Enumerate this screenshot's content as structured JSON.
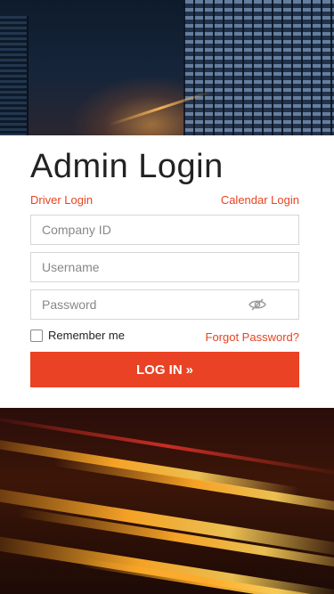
{
  "login": {
    "title": "Admin Login",
    "driver_link": "Driver Login",
    "calendar_link": "Calendar Login",
    "company_placeholder": "Company ID",
    "username_placeholder": "Username",
    "password_placeholder": "Password",
    "remember_label": "Remember me",
    "remember_checked": false,
    "forgot_link": "Forgot Password?",
    "login_button": "LOG IN",
    "login_button_icon": "double-chevron-right-icon",
    "password_toggle_icon": "eye-slash-icon"
  },
  "colors": {
    "accent": "#ea4224",
    "link": "#e84422",
    "card_background": "#ffffff",
    "field_border": "#d6d6d6"
  }
}
